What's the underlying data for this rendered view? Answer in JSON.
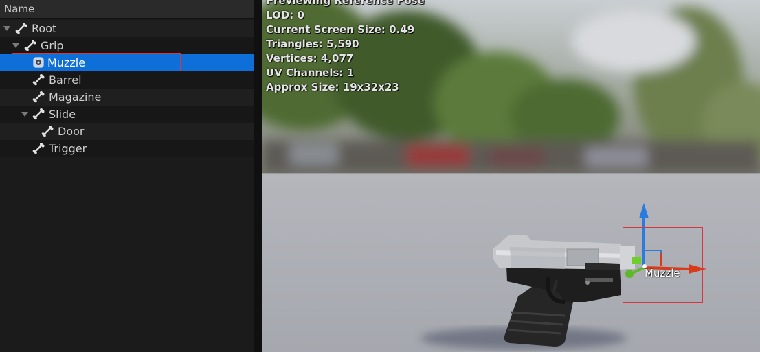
{
  "tree": {
    "header": "Name",
    "rows": [
      {
        "label": "Root",
        "type": "bone",
        "selected": false
      },
      {
        "label": "Grip",
        "type": "bone",
        "selected": false
      },
      {
        "label": "Muzzle",
        "type": "socket",
        "selected": true
      },
      {
        "label": "Barrel",
        "type": "bone",
        "selected": false
      },
      {
        "label": "Magazine",
        "type": "bone",
        "selected": false
      },
      {
        "label": "Slide",
        "type": "bone",
        "selected": false
      },
      {
        "label": "Door",
        "type": "bone",
        "selected": false
      },
      {
        "label": "Trigger",
        "type": "bone",
        "selected": false
      }
    ]
  },
  "viewport": {
    "stats": [
      "Previewing Reference Pose",
      "LOD: 0",
      "Current Screen Size: 0.49",
      "Triangles: 5,590",
      "Vertices: 4,077",
      "UV Channels: 1",
      "Approx Size: 19x32x23"
    ],
    "socket_label": "Muzzle"
  },
  "colors": {
    "selection": "#0e6fd9",
    "highlight_outline": "#d9363e",
    "gizmo_x": "#d93a1a",
    "gizmo_y": "#5fb82a",
    "gizmo_z": "#2a7be0"
  },
  "icons": {
    "bone": "bone-icon",
    "socket": "socket-icon",
    "expander": "expander-arrow-icon"
  }
}
